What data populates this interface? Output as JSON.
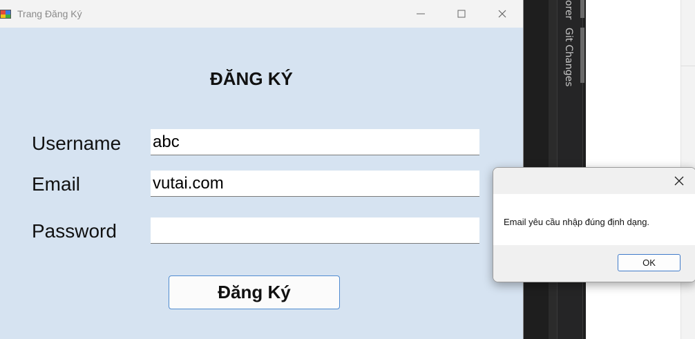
{
  "window": {
    "title": "Trang Đăng Ký",
    "controls": {
      "minimize": "minimize-icon",
      "maximize": "maximize-icon",
      "close": "close-icon"
    }
  },
  "form": {
    "heading": "ĐĂNG KÝ",
    "username_label": "Username",
    "username_value": "abc",
    "email_label": "Email",
    "email_value": "vutai.com",
    "password_label": "Password",
    "password_value": "",
    "submit_label": "Đăng Ký"
  },
  "dialog": {
    "message": "Email yêu cầu nhập đúng định dạng.",
    "ok_label": "OK"
  },
  "ide": {
    "tab_explorer": "orer",
    "tab_git": "Git Changes"
  },
  "colors": {
    "form_background": "#d6e3f1",
    "button_border": "#4f8bd0"
  }
}
